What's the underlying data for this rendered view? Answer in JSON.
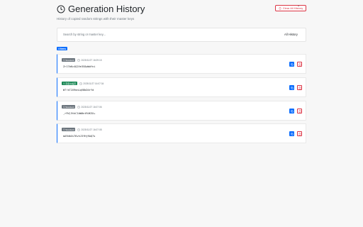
{
  "header": {
    "title": "Generation History",
    "subtitle": "History of copied random strings with their master keys"
  },
  "toolbar": {
    "clear_label": "Clear All History"
  },
  "filter": {
    "search_placeholder": "Search by string or master key...",
    "selected_option": "All History"
  },
  "count_badge": "4 Items",
  "items": [
    {
      "tag": "Standard",
      "tag_color": "gray",
      "timestamp": "2025/11/27 16:09:15",
      "value": "Zr17bKc4Q2Ve3S0pWdfni"
    },
    {
      "tag": "高度な設定",
      "tag_color": "green",
      "timestamp": "2025/11/27 16:07:34",
      "value": "W7!kT2X9mnLqV8bD4rYd"
    },
    {
      "tag": "Standard",
      "tag_color": "gray",
      "timestamp": "2025/11/27 16:07:06",
      "value": "_r9Vj5tkC1bW0ntR4K3X+"
    },
    {
      "tag": "Standard",
      "tag_color": "gray",
      "timestamp": "2025/11/27 16:07:08",
      "value": "mA9dbXsT6vhJ3fHjRAQ7s"
    }
  ],
  "colors": {
    "accent": "#0d6efd",
    "danger": "#dc3545",
    "standard_tag": "#6c757d",
    "advanced_tag": "#198754"
  }
}
